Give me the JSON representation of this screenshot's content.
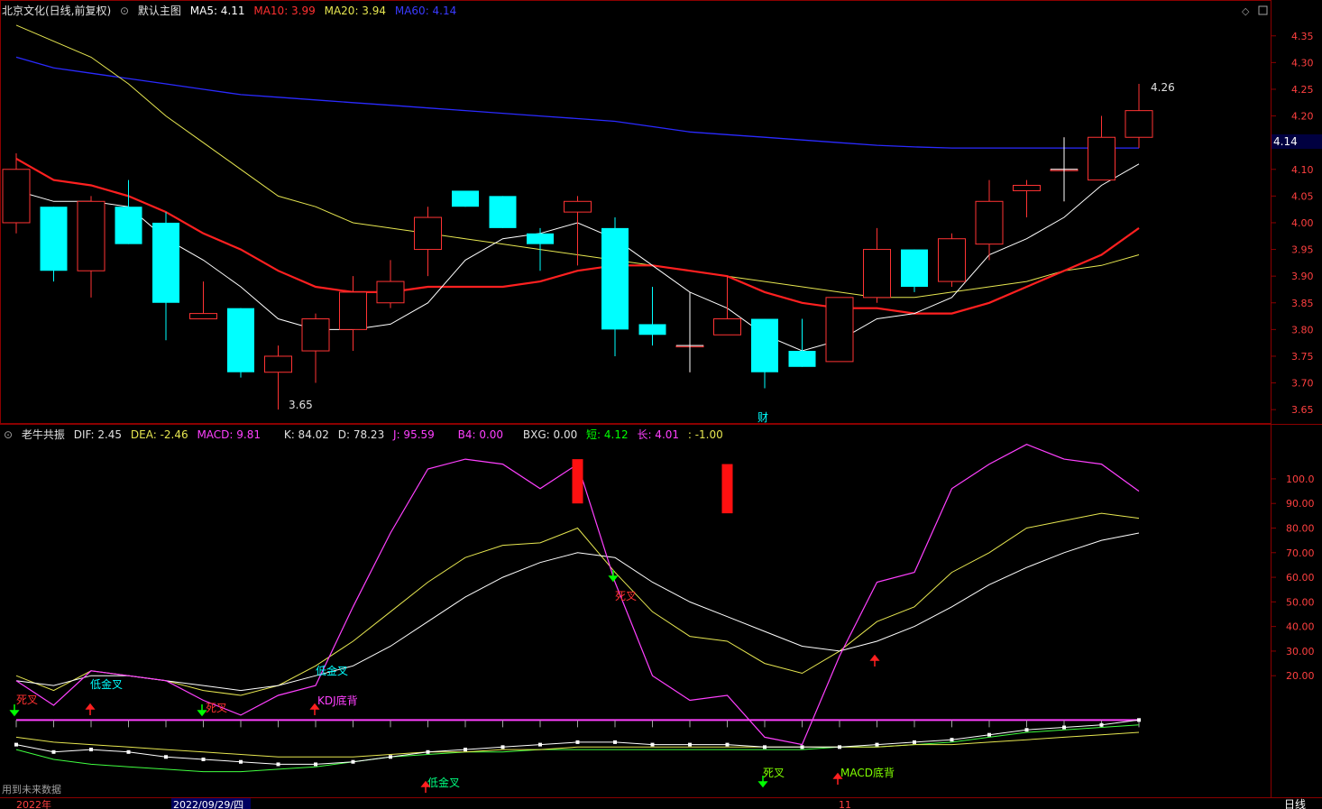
{
  "main_header": {
    "stock": "北京文化(日线,前复权)",
    "template": "默认主图",
    "ma5": "MA5: 4.11",
    "ma10": "MA10: 3.99",
    "ma20": "MA20: 3.94",
    "ma60": "MA60: 4.14"
  },
  "sub_header": {
    "name": "老牛共振",
    "dif": "DIF: 2.45",
    "dea": "DEA: -2.46",
    "macd": "MACD: 9.81",
    "k": "K: 84.02",
    "d": "D: 78.23",
    "j": "J: 95.59",
    "b4": "B4: 0.00",
    "bxg": "BXG: 0.00",
    "short": "短: 4.12",
    "long": "长: 4.01",
    "tail": ": -1.00"
  },
  "colors": {
    "up": "#ff3333",
    "down": "#00ffff",
    "ma5": "#ffffff",
    "ma10": "#ff2020",
    "ma20": "#e6e650",
    "ma60": "#2a2aff",
    "k": "#ffffff",
    "d": "#e6e650",
    "j": "#ff40ff",
    "frame": "#8b0000"
  },
  "price_axis": [
    "4.35",
    "4.30",
    "4.25",
    "4.20",
    "4.15",
    "4.10",
    "4.05",
    "4.00",
    "3.95",
    "3.90",
    "3.85",
    "3.80",
    "3.75",
    "3.70",
    "3.65"
  ],
  "current_price_tag": "4.14",
  "sub_axis": [
    "100.0",
    "90.00",
    "80.00",
    "70.00",
    "60.00",
    "50.00",
    "40.00",
    "30.00",
    "20.00"
  ],
  "annotations": {
    "high": "4.26",
    "low": "3.65",
    "cai": "财"
  },
  "signals": [
    {
      "text": "低金叉",
      "color": "#00ffff"
    },
    {
      "text": "低金叉",
      "color": "#00ffff"
    },
    {
      "text": "死叉",
      "color": "#ff3030"
    },
    {
      "text": "KDJ底背",
      "color": "#ff40ff"
    },
    {
      "text": "死叉",
      "color": "#ff3030"
    },
    {
      "text": "死叉",
      "color": "#ff3030"
    },
    {
      "text": "低金叉",
      "color": "#00ff80"
    },
    {
      "text": "死叉",
      "color": "#80ff00"
    },
    {
      "text": "MACD底背",
      "color": "#80ff00"
    }
  ],
  "footer": {
    "future": "用到未来数据",
    "year": "2022年",
    "date": "2022/09/29/四",
    "month": "11",
    "period": "日线"
  },
  "chart_data": {
    "type": "candlestick",
    "ylim": [
      3.63,
      4.38
    ],
    "candles": [
      {
        "o": 4.0,
        "c": 4.1,
        "h": 4.13,
        "l": 3.98
      },
      {
        "o": 4.03,
        "c": 3.91,
        "h": 4.03,
        "l": 3.89
      },
      {
        "o": 3.91,
        "c": 4.04,
        "h": 4.05,
        "l": 3.86
      },
      {
        "o": 4.03,
        "c": 3.96,
        "h": 4.08,
        "l": 3.96
      },
      {
        "o": 4.0,
        "c": 3.85,
        "h": 4.02,
        "l": 3.78
      },
      {
        "o": 3.82,
        "c": 3.83,
        "h": 3.89,
        "l": 3.82
      },
      {
        "o": 3.84,
        "c": 3.72,
        "h": 3.84,
        "l": 3.71
      },
      {
        "o": 3.72,
        "c": 3.75,
        "h": 3.77,
        "l": 3.65
      },
      {
        "o": 3.76,
        "c": 3.82,
        "h": 3.83,
        "l": 3.7
      },
      {
        "o": 3.8,
        "c": 3.87,
        "h": 3.9,
        "l": 3.76
      },
      {
        "o": 3.85,
        "c": 3.89,
        "h": 3.93,
        "l": 3.84
      },
      {
        "o": 3.95,
        "c": 4.01,
        "h": 4.03,
        "l": 3.9
      },
      {
        "o": 4.06,
        "c": 4.03,
        "h": 4.06,
        "l": 4.03
      },
      {
        "o": 4.05,
        "c": 3.99,
        "h": 4.05,
        "l": 3.99
      },
      {
        "o": 3.98,
        "c": 3.96,
        "h": 3.99,
        "l": 3.91
      },
      {
        "o": 4.02,
        "c": 4.04,
        "h": 4.05,
        "l": 3.92
      },
      {
        "o": 3.99,
        "c": 3.8,
        "h": 4.01,
        "l": 3.75
      },
      {
        "o": 3.81,
        "c": 3.79,
        "h": 3.88,
        "l": 3.77
      },
      {
        "o": 3.77,
        "c": 3.77,
        "h": 3.87,
        "l": 3.72
      },
      {
        "o": 3.79,
        "c": 3.82,
        "h": 3.9,
        "l": 3.79
      },
      {
        "o": 3.82,
        "c": 3.72,
        "h": 3.82,
        "l": 3.69
      },
      {
        "o": 3.76,
        "c": 3.73,
        "h": 3.82,
        "l": 3.73
      },
      {
        "o": 3.74,
        "c": 3.86,
        "h": 3.86,
        "l": 3.74
      },
      {
        "o": 3.86,
        "c": 3.95,
        "h": 3.99,
        "l": 3.85
      },
      {
        "o": 3.95,
        "c": 3.88,
        "h": 3.95,
        "l": 3.87
      },
      {
        "o": 3.89,
        "c": 3.97,
        "h": 3.98,
        "l": 3.88
      },
      {
        "o": 3.96,
        "c": 4.04,
        "h": 4.08,
        "l": 3.93
      },
      {
        "o": 4.06,
        "c": 4.07,
        "h": 4.08,
        "l": 4.01
      },
      {
        "o": 4.1,
        "c": 4.1,
        "h": 4.16,
        "l": 4.04
      },
      {
        "o": 4.08,
        "c": 4.16,
        "h": 4.2,
        "l": 4.08
      },
      {
        "o": 4.16,
        "c": 4.21,
        "h": 4.26,
        "l": 4.14
      }
    ],
    "ma5": [
      4.06,
      4.04,
      4.04,
      4.03,
      3.97,
      3.93,
      3.88,
      3.82,
      3.8,
      3.8,
      3.81,
      3.85,
      3.93,
      3.97,
      3.98,
      4.0,
      3.97,
      3.92,
      3.87,
      3.84,
      3.79,
      3.76,
      3.78,
      3.82,
      3.83,
      3.86,
      3.94,
      3.97,
      4.01,
      4.07,
      4.11
    ],
    "ma10": [
      4.12,
      4.08,
      4.07,
      4.05,
      4.02,
      3.98,
      3.95,
      3.91,
      3.88,
      3.87,
      3.87,
      3.88,
      3.88,
      3.88,
      3.89,
      3.91,
      3.92,
      3.92,
      3.91,
      3.9,
      3.87,
      3.85,
      3.84,
      3.84,
      3.83,
      3.83,
      3.85,
      3.88,
      3.91,
      3.94,
      3.99
    ],
    "ma20": [
      4.37,
      4.34,
      4.31,
      4.26,
      4.2,
      4.15,
      4.1,
      4.05,
      4.03,
      4.0,
      3.99,
      3.98,
      3.97,
      3.96,
      3.95,
      3.94,
      3.93,
      3.92,
      3.91,
      3.9,
      3.89,
      3.88,
      3.87,
      3.86,
      3.86,
      3.87,
      3.88,
      3.89,
      3.91,
      3.92,
      3.94
    ],
    "ma60": [
      4.31,
      4.29,
      4.28,
      4.27,
      4.26,
      4.25,
      4.24,
      4.235,
      4.23,
      4.225,
      4.22,
      4.215,
      4.21,
      4.205,
      4.2,
      4.195,
      4.19,
      4.18,
      4.17,
      4.165,
      4.16,
      4.155,
      4.15,
      4.145,
      4.142,
      4.14,
      4.14,
      4.14,
      4.14,
      4.14,
      4.14
    ],
    "sub_ylim": [
      -25,
      115
    ],
    "k": [
      18,
      16,
      20,
      20,
      18,
      16,
      14,
      16,
      20,
      24,
      32,
      42,
      52,
      60,
      66,
      70,
      68,
      58,
      50,
      44,
      38,
      32,
      30,
      34,
      40,
      48,
      57,
      64,
      70,
      75,
      78
    ],
    "d": [
      20,
      14,
      22,
      20,
      18,
      14,
      12,
      16,
      24,
      34,
      46,
      58,
      68,
      73,
      74,
      80,
      62,
      46,
      36,
      34,
      25,
      21,
      30,
      42,
      48,
      62,
      70,
      80,
      83,
      86,
      84
    ],
    "j": [
      18,
      8,
      22,
      20,
      18,
      10,
      4,
      12,
      16,
      48,
      78,
      104,
      108,
      106,
      96,
      106,
      58,
      20,
      10,
      12,
      -5,
      -8,
      28,
      58,
      62,
      96,
      106,
      114,
      108,
      106,
      95
    ],
    "red_bars": [
      {
        "i": 15,
        "top": 108,
        "bottom": 90
      },
      {
        "i": 19,
        "top": 106,
        "bottom": 86
      }
    ],
    "macd_line_white": [
      -8,
      -11,
      -10,
      -11,
      -13,
      -14,
      -15,
      -16,
      -16,
      -15,
      -13,
      -11,
      -10,
      -9,
      -8,
      -7,
      -7,
      -8,
      -8,
      -8,
      -9,
      -9,
      -9,
      -8,
      -7,
      -6,
      -4,
      -2,
      -1,
      0,
      2
    ],
    "macd_line_yellow": [
      -5,
      -7,
      -8,
      -9,
      -10,
      -11,
      -12,
      -13,
      -13,
      -13,
      -12,
      -11,
      -11,
      -10,
      -10,
      -9,
      -9,
      -9,
      -9,
      -9,
      -9,
      -9,
      -9,
      -9,
      -8,
      -8,
      -7,
      -6,
      -5,
      -4,
      -3
    ],
    "macd_line_green": [
      -10,
      -14,
      -16,
      -17,
      -18,
      -19,
      -19,
      -18,
      -17,
      -15,
      -13,
      -12,
      -11,
      -11,
      -10,
      -10,
      -10,
      -10,
      -10,
      -10,
      -10,
      -10,
      -9,
      -9,
      -8,
      -7,
      -5,
      -3,
      -2,
      -1,
      0
    ],
    "bxg_line": 2
  }
}
